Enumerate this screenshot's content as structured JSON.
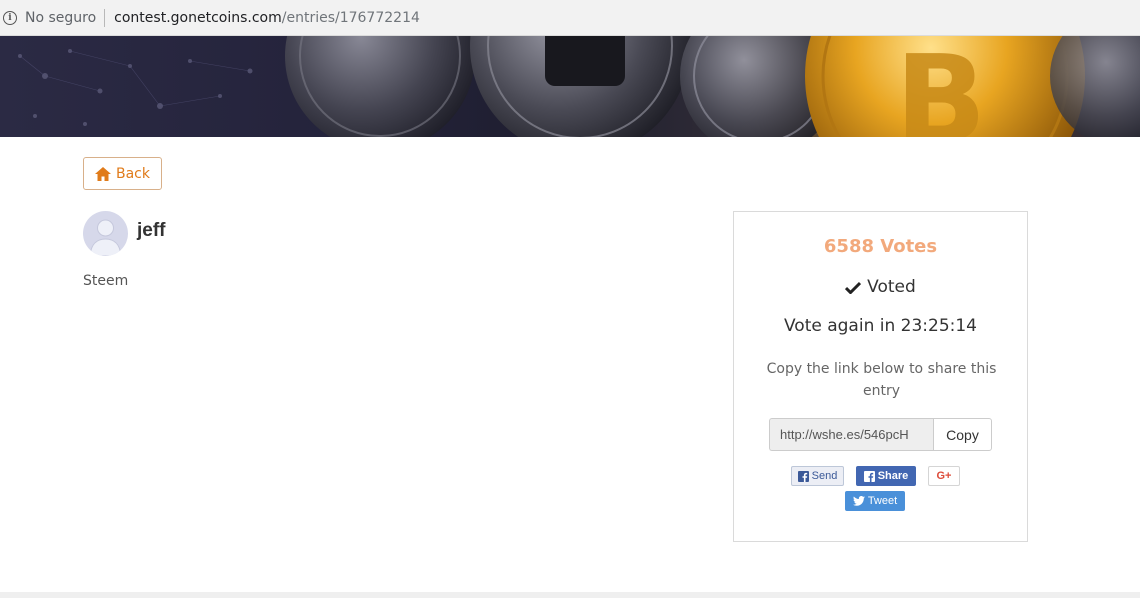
{
  "browser": {
    "security_label": "No seguro",
    "url_host": "contest.gonetcoins.com",
    "url_path": "/entries/176772214"
  },
  "page": {
    "back_label": "Back"
  },
  "entrant": {
    "name": "jeff",
    "entry_text": "Steem"
  },
  "vote_panel": {
    "votes_text": "6588 Votes",
    "voted_label": "Voted",
    "vote_again_text": "Vote again in 23:25:14",
    "copy_hint": "Copy the link below to share this entry",
    "share_link": "http://wshe.es/546pcH",
    "copy_label": "Copy",
    "buttons": {
      "send": "Send",
      "share": "Share",
      "gplus": "G+",
      "tweet": "Tweet"
    }
  },
  "colors": {
    "accent_orange": "#e07b1a",
    "votes_color": "#f2a97c",
    "facebook_blue": "#4267b2",
    "twitter_blue": "#4a90d9",
    "gplus_red": "#dd4b39"
  },
  "icons": [
    "info-icon",
    "home-icon",
    "check-icon",
    "facebook-icon",
    "twitter-icon"
  ]
}
